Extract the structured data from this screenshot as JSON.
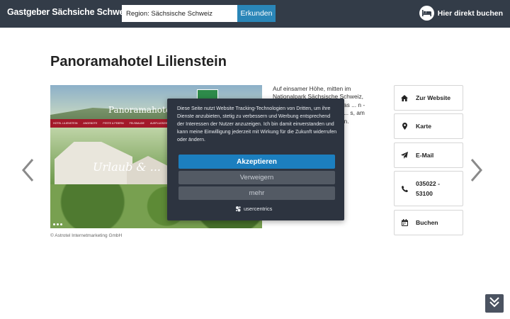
{
  "header": {
    "brand": "Gastgeber Sächsiche Schweiz",
    "search": {
      "value": "Region: Sächsische Schweiz",
      "button_label": "Erkunden"
    },
    "book_cta": {
      "label": "Hier direkt buchen",
      "icon": "bed-icon"
    }
  },
  "main": {
    "title": "Panoramahotel Lilienstein",
    "hero": {
      "hotel_name": "Panoramahotel",
      "script_text": "Urlaub & ...",
      "menu_items": [
        "HOTEL LILIENSTEIN",
        "ANGEBOTE",
        "FESTE & FEIERN",
        "FELSBAUDE",
        "AUSFLUGSZIELE"
      ],
      "caption": "© Astrotel Internetmarketing GmbH"
    },
    "description": "Auf einsamer Höhe, mitten im Nationalpark Sächsische Schweiz, ... schroffen ... ern und ... das ... n - Ihr ... enießen ... ern diese ... s, am Fuße ... d von der ... werden."
  },
  "sidebar": {
    "items": [
      {
        "label": "Zur Website",
        "icon": "home-icon"
      },
      {
        "label": "Karte",
        "icon": "map-marker-icon"
      },
      {
        "label": "E-Mail",
        "icon": "paper-plane-icon"
      },
      {
        "label": "035022 - 53100",
        "icon": "phone-icon"
      },
      {
        "label": "Buchen",
        "icon": "calendar-icon"
      }
    ]
  },
  "consent": {
    "text": "Diese Seite nutzt Website Tracking-Technologien von Dritten, um ihre Dienste anzubieten, stetig zu verbessern und Werbung entsprechend der Interessen der Nutzer anzuzeigen. Ich bin damit einverstanden und kann meine Einwilligung jederzeit mit Wirkung für die Zukunft widerrufen oder ändern.",
    "accept_label": "Akzeptieren",
    "deny_label": "Verweigern",
    "more_label": "mehr",
    "provider": "usercentrics"
  },
  "colors": {
    "header_bg": "#333c48",
    "accent_blue": "#2a86b8",
    "consent_bg": "#2d3440",
    "accept_bg": "#1c7fbf"
  }
}
